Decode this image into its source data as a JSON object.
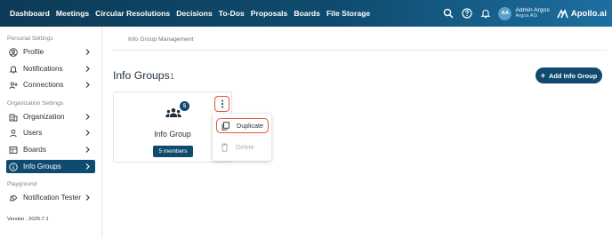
{
  "nav": {
    "items": [
      "Dashboard",
      "Meetings",
      "Circular Resolutions",
      "Decisions",
      "To-Dos",
      "Proposals",
      "Boards",
      "File Storage"
    ]
  },
  "user": {
    "initials": "AA",
    "name": "Admin Argos",
    "org": "Argos AG"
  },
  "logo": {
    "text": "Apollo.ai"
  },
  "sidebar": {
    "personal_title": "Personal Settings",
    "personal_items": [
      {
        "label": "Profile",
        "icon": "profile-icon"
      },
      {
        "label": "Notifications",
        "icon": "bell-icon"
      },
      {
        "label": "Connections",
        "icon": "connections-icon"
      }
    ],
    "org_title": "Organization Settings",
    "org_items": [
      {
        "label": "Organization",
        "icon": "building-icon"
      },
      {
        "label": "Users",
        "icon": "user-icon"
      },
      {
        "label": "Boards",
        "icon": "boards-icon"
      },
      {
        "label": "Info Groups",
        "icon": "info-icon",
        "active": true
      }
    ],
    "playground_title": "Playground",
    "playground_items": [
      {
        "label": "Notification Tester",
        "icon": "tester-icon"
      }
    ],
    "version": "Version : 2025.7.1"
  },
  "main": {
    "breadcrumb": "Info Group Management",
    "title": "Info Groups",
    "count": "1",
    "add_button": "Add Info Group",
    "card": {
      "title": "Info Group",
      "badge": "5",
      "members": "5 members"
    },
    "menu": {
      "duplicate": "Duplicate",
      "delete": "Delete"
    }
  },
  "colors": {
    "primary": "#0f4b6e",
    "highlight": "#e0553b"
  }
}
